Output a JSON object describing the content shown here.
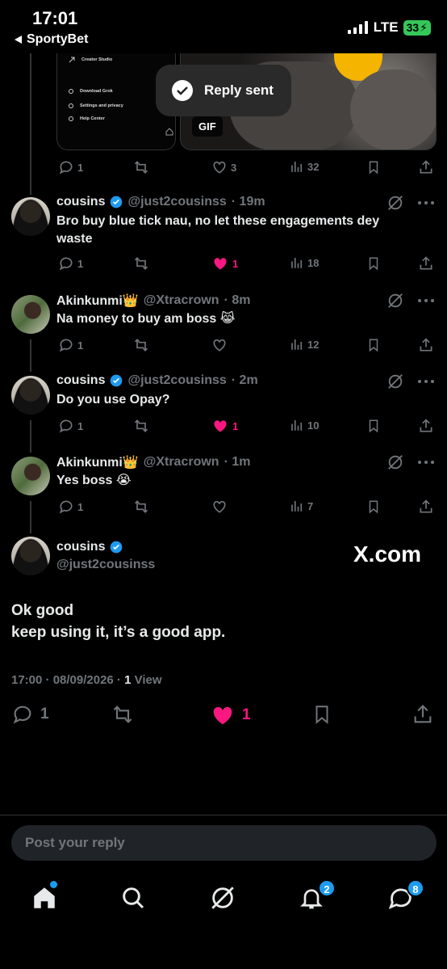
{
  "status_bar": {
    "time": "17:01",
    "back_app": "SportyBet",
    "network": "LTE",
    "battery": "33"
  },
  "toast": {
    "text": "Reply sent"
  },
  "media": {
    "menu": [
      "Creator Studio",
      "Download Grok",
      "Settings and privacy",
      "Help Center"
    ],
    "gif_label": "GIF"
  },
  "prev_tweet_actions": {
    "replies": "1",
    "retweets": "",
    "likes": "3",
    "views": "32"
  },
  "tweets": [
    {
      "name": "cousins",
      "verified": true,
      "handle": "@just2cousinss",
      "time": "· 19m",
      "text": "Bro buy blue tick nau, no let these engagements dey waste",
      "replies": "1",
      "likes": "1",
      "liked": true,
      "views": "18"
    },
    {
      "name": "Akinkunmi👑",
      "verified": false,
      "handle": "@Xtracrown",
      "time": "· 8m",
      "text": "Na money to buy am boss 😹",
      "replies": "1",
      "likes": "",
      "liked": false,
      "views": "12"
    },
    {
      "name": "cousins",
      "verified": true,
      "handle": "@just2cousinss",
      "time": "· 2m",
      "text": "Do you use Opay?",
      "replies": "1",
      "likes": "1",
      "liked": true,
      "views": "10"
    },
    {
      "name": "Akinkunmi👑",
      "verified": false,
      "handle": "@Xtracrown",
      "time": "· 1m",
      "text": "Yes boss 😭",
      "replies": "1",
      "likes": "",
      "liked": false,
      "views": "7"
    }
  ],
  "main_tweet": {
    "name": "cousins",
    "handle": "@just2cousinss",
    "watermark": "X.com",
    "line1": "Ok good",
    "line2": "keep using it, it’s a good app.",
    "timestamp": "17:00 · 08/09/2026 · ",
    "views_count": "1",
    "views_label": " View",
    "replies": "1",
    "likes": "1"
  },
  "reply_placeholder": "Post your reply",
  "bottom_nav": {
    "notifications_badge": "2",
    "messages_badge": "8"
  },
  "colors": {
    "like": "#f91880",
    "verified": "#1d9bf0",
    "muted": "#71767b"
  },
  "icons": [
    "reply-icon",
    "retweet-icon",
    "heart-icon",
    "views-icon",
    "bookmark-icon",
    "share-icon",
    "grok-icon",
    "more-icon",
    "home-icon",
    "search-icon",
    "bell-icon",
    "messages-icon"
  ]
}
